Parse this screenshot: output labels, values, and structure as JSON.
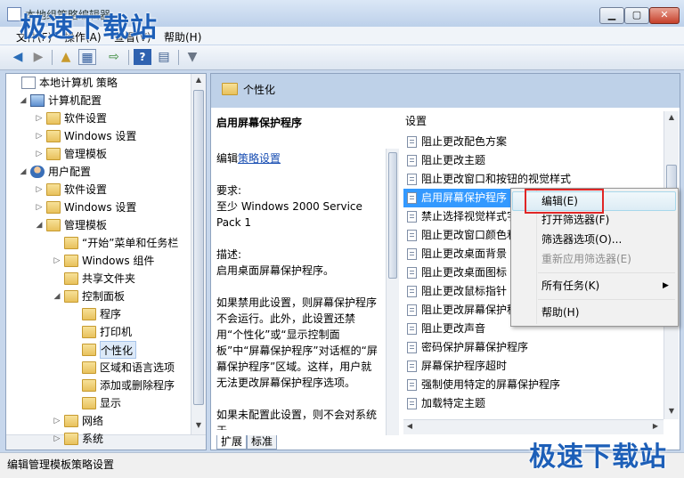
{
  "window": {
    "title": "本地组策略编辑器"
  },
  "watermark": {
    "text": "极速下载站"
  },
  "menu": [
    "文件(F)",
    "操作(A)",
    "查看(V)",
    "帮助(H)"
  ],
  "toolbar": {
    "icons": [
      "back-arrow-icon",
      "forward-arrow-icon",
      "up-folder-icon",
      "show-tree-icon",
      "export-list-icon",
      "help-icon",
      "properties-icon",
      "filter-icon"
    ]
  },
  "tree": [
    {
      "label": "本地计算机 策略",
      "level": 0,
      "expander": "",
      "icon": "doc"
    },
    {
      "label": "计算机配置",
      "level": 1,
      "expander": "open",
      "icon": "computer"
    },
    {
      "label": "软件设置",
      "level": 2,
      "expander": "closed",
      "icon": "folder"
    },
    {
      "label": "Windows 设置",
      "level": 2,
      "expander": "closed",
      "icon": "folder"
    },
    {
      "label": "管理模板",
      "level": 2,
      "expander": "closed",
      "icon": "folder"
    },
    {
      "label": "用户配置",
      "level": 1,
      "expander": "open",
      "icon": "user"
    },
    {
      "label": "软件设置",
      "level": 2,
      "expander": "closed",
      "icon": "folder"
    },
    {
      "label": "Windows 设置",
      "level": 2,
      "expander": "closed",
      "icon": "folder"
    },
    {
      "label": "管理模板",
      "level": 2,
      "expander": "open",
      "icon": "folder"
    },
    {
      "label": "“开始”菜单和任务栏",
      "level": 3,
      "expander": "",
      "icon": "folder"
    },
    {
      "label": "Windows 组件",
      "level": 3,
      "expander": "closed",
      "icon": "folder"
    },
    {
      "label": "共享文件夹",
      "level": 3,
      "expander": "",
      "icon": "folder"
    },
    {
      "label": "控制面板",
      "level": 3,
      "expander": "open",
      "icon": "folder"
    },
    {
      "label": "程序",
      "level": 4,
      "expander": "",
      "icon": "folder"
    },
    {
      "label": "打印机",
      "level": 4,
      "expander": "",
      "icon": "folder"
    },
    {
      "label": "个性化",
      "level": 4,
      "expander": "",
      "icon": "folder",
      "selected": true
    },
    {
      "label": "区域和语言选项",
      "level": 4,
      "expander": "",
      "icon": "folder"
    },
    {
      "label": "添加或删除程序",
      "level": 4,
      "expander": "",
      "icon": "folder"
    },
    {
      "label": "显示",
      "level": 4,
      "expander": "",
      "icon": "folder"
    },
    {
      "label": "网络",
      "level": 3,
      "expander": "closed",
      "icon": "folder"
    },
    {
      "label": "系统",
      "level": 3,
      "expander": "closed",
      "icon": "folder"
    }
  ],
  "panel": {
    "title": "个性化",
    "settings_header": "设置"
  },
  "description": {
    "title": "启用屏幕保护程序",
    "edit_prefix": "编辑",
    "edit_link": "策略设置",
    "req_label": "要求:",
    "req_value": "至少 Windows 2000 Service Pack 1",
    "desc_label": "描述:",
    "desc_value": "启用桌面屏幕保护程序。",
    "para1": "如果禁用此设置，则屏幕保护程序不会运行。此外，此设置还禁用“个性化”或“显示控制面板”中“屏幕保护程序”对话框的“屏幕保护程序”区域。这样，用户就无法更改屏幕保护程序选项。",
    "para2": "如果未配置此设置，则不会对系统于"
  },
  "settings": [
    "阻止更改配色方案",
    "阻止更改主题",
    "阻止更改窗口和按钮的视觉样式",
    "启用屏幕保护程序",
    "禁止选择视觉样式字",
    "阻止更改窗口颜色和",
    "阻止更改桌面背景",
    "阻止更改桌面图标",
    "阻止更改鼠标指针",
    "阻止更改屏幕保护程",
    "阻止更改声音",
    "密码保护屏幕保护程序",
    "屏幕保护程序超时",
    "强制使用特定的屏幕保护程序",
    "加载特定主题"
  ],
  "context_menu": {
    "edit": "编辑(E)",
    "open_filter": "打开筛选器(F)",
    "filter_options": "筛选器选项(O)...",
    "reapply_filter": "重新应用筛选器(E)",
    "all_tasks": "所有任务(K)",
    "help": "帮助(H)"
  },
  "tabs": [
    "扩展",
    "标准"
  ],
  "status": "编辑管理模板策略设置"
}
